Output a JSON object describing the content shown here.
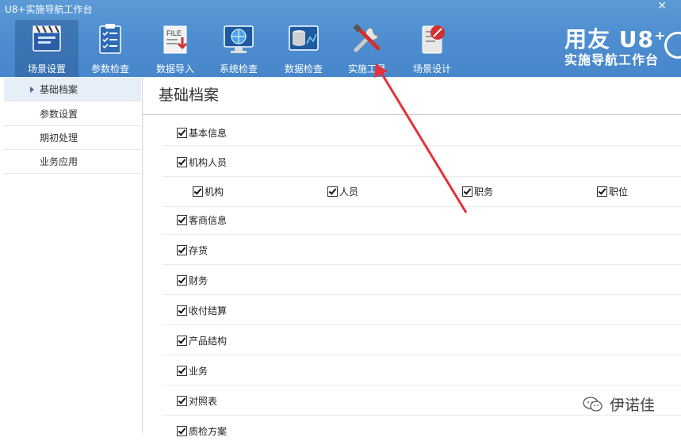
{
  "window": {
    "title": "U8+实施导航工作台",
    "close_glyph": "×"
  },
  "toolbar": {
    "items": [
      {
        "label": "场景设置",
        "icon": "scene-settings-icon",
        "active": true
      },
      {
        "label": "参数检查",
        "icon": "clipboard-checklist-icon"
      },
      {
        "label": "数据导入",
        "icon": "file-import-icon"
      },
      {
        "label": "系统检查",
        "icon": "monitor-globe-icon"
      },
      {
        "label": "数据检查",
        "icon": "database-check-icon"
      },
      {
        "label": "实施工具",
        "icon": "tools-icon"
      },
      {
        "label": "场景设计",
        "icon": "design-pen-icon"
      }
    ]
  },
  "brand": {
    "line1": "用友 U8⁺",
    "line2": "实施导航工作台"
  },
  "sidebar": {
    "items": [
      {
        "label": "基础档案",
        "selected": true
      },
      {
        "label": "参数设置"
      },
      {
        "label": "期初处理"
      },
      {
        "label": "业务应用"
      }
    ]
  },
  "main": {
    "title": "基础档案",
    "rows": [
      {
        "label": "基本信息",
        "checked": true
      },
      {
        "label": "机构人员",
        "checked": true
      },
      {
        "sub": [
          {
            "label": "机构",
            "checked": true
          },
          {
            "label": "人员",
            "checked": true
          },
          {
            "label": "职务",
            "checked": true
          },
          {
            "label": "职位",
            "checked": true
          }
        ]
      },
      {
        "label": "客商信息",
        "checked": true
      },
      {
        "label": "存货",
        "checked": true
      },
      {
        "label": "财务",
        "checked": true
      },
      {
        "label": "收付结算",
        "checked": true
      },
      {
        "label": "产品结构",
        "checked": true
      },
      {
        "label": "业务",
        "checked": true
      },
      {
        "label": "对照表",
        "checked": true
      },
      {
        "label": "质检方案",
        "checked": true
      }
    ]
  },
  "watermark": {
    "text": "伊诺佳"
  },
  "colors": {
    "header_blue": "#4f8fd0",
    "annotation_red": "#e8303a"
  }
}
